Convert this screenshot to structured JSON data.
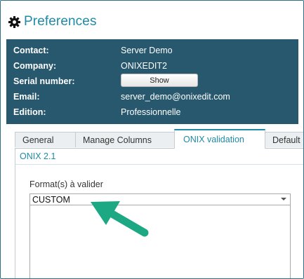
{
  "header": {
    "title": "Preferences",
    "icon": "gear-icon"
  },
  "info": {
    "contact": {
      "label": "Contact:",
      "value": "Server Demo"
    },
    "company": {
      "label": "Company:",
      "value": "ONIXEDIT2"
    },
    "serial": {
      "label": "Serial number:",
      "button_label": "Show"
    },
    "email": {
      "label": "Email:",
      "value": "server_demo@onixedit.com"
    },
    "edition": {
      "label": "Edition:",
      "value": "Professionnelle"
    }
  },
  "tabs": [
    {
      "label": "General"
    },
    {
      "label": "Manage Columns"
    },
    {
      "label": "ONIX validation",
      "active": true
    },
    {
      "label": "Default"
    }
  ],
  "validation": {
    "section_title": "ONIX 2.1",
    "format_label": "Format(s) à valider",
    "selected_format": "CUSTOM"
  },
  "colors": {
    "accent": "#1f8aa6",
    "panel": "#27586e",
    "annotation_arrow": "#1ba882"
  }
}
